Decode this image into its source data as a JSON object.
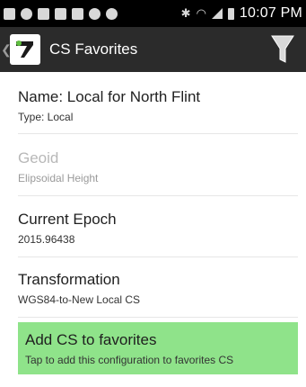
{
  "status_bar": {
    "time": "10:07 PM",
    "icons": [
      "message-icon",
      "sync-icon",
      "usb-icon",
      "image-icon",
      "facebook-icon",
      "vibrate-icon",
      "vibrate-icon",
      "bluetooth-icon",
      "wifi-icon",
      "signal-icon",
      "battery-icon"
    ]
  },
  "action_bar": {
    "title": "CS Favorites",
    "filter_icon": "filter-icon",
    "logo_icon": "app-logo-icon"
  },
  "items": [
    {
      "title": "Name: Local for North Flint",
      "subtitle": "Type:   Local",
      "enabled": true
    },
    {
      "title": "Geoid",
      "subtitle": "Elipsoidal Height",
      "enabled": false
    },
    {
      "title": "Current Epoch",
      "subtitle": "2015.96438",
      "enabled": true
    },
    {
      "title": "Transformation",
      "subtitle": "WGS84-to-New Local CS",
      "enabled": true
    }
  ],
  "action_item": {
    "title": "Add CS to favorites",
    "subtitle": "Tap to add this configuration to favorites CS"
  },
  "colors": {
    "status_bar": "#000000",
    "action_bar": "#2b2b2b",
    "highlight": "#8fe38a"
  }
}
